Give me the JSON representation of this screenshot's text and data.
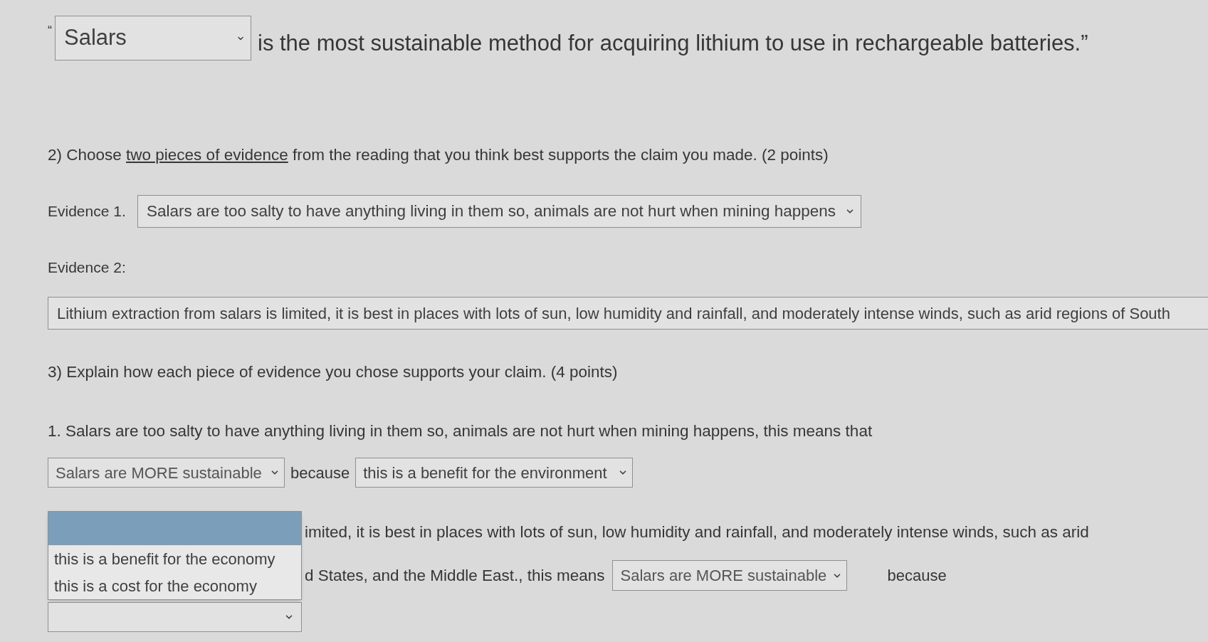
{
  "claim": {
    "open_quote": "“",
    "select": {
      "value": "Salars"
    },
    "text": "is the most sustainable method for acquiring lithium to use in rechargeable batteries.”"
  },
  "question_2": {
    "prompt_parts": [
      {
        "text": "2) Choose ",
        "underlined": false
      },
      {
        "text": "two pieces of evidence",
        "underlined": true
      },
      {
        "text": " from the reading that you think best supports the claim you made. (2 points)",
        "underlined": false
      }
    ]
  },
  "evidence": [
    {
      "kind": "inline",
      "label": "Evidence 1.",
      "value": "Salars are too salty to have anything living in them so, animals are not hurt when mining happens"
    },
    {
      "kind": "stacked",
      "label": "Evidence 2:",
      "value": "Lithium extraction from salars is limited, it is best in places with lots of sun, low humidity and rainfall, and moderately intense winds, such as arid regions of South"
    }
  ],
  "question_3": {
    "prompt": "3) Explain how each piece of evidence you chose supports your claim. (4 points)",
    "items": [
      {
        "kind": "row",
        "lines": [
          "1. Salars are too salty to have anything living in them so, animals are not hurt when mining happens, this means that"
        ],
        "claim_select": {
          "value": "Salars are MORE sustainable"
        },
        "connector": "because",
        "reason_select": {
          "value": "this is a benefit for the environment",
          "expanded": false
        }
      },
      {
        "kind": "covered",
        "lines": [
          "imited, it is best in places with lots of sun, low humidity and rainfall, and moderately intense winds, such as arid",
          "d States, and the Middle East., this means"
        ],
        "claim_select": {
          "value": "Salars are MORE sustainable"
        },
        "connector": "because",
        "reason_select": {
          "expanded": true,
          "options": [
            {
              "selected": true
            },
            {
              "label": "this is a benefit for the economy",
              "selected": false
            },
            {
              "label": "this is a cost for the economy",
              "selected": false
            }
          ]
        }
      }
    ]
  }
}
